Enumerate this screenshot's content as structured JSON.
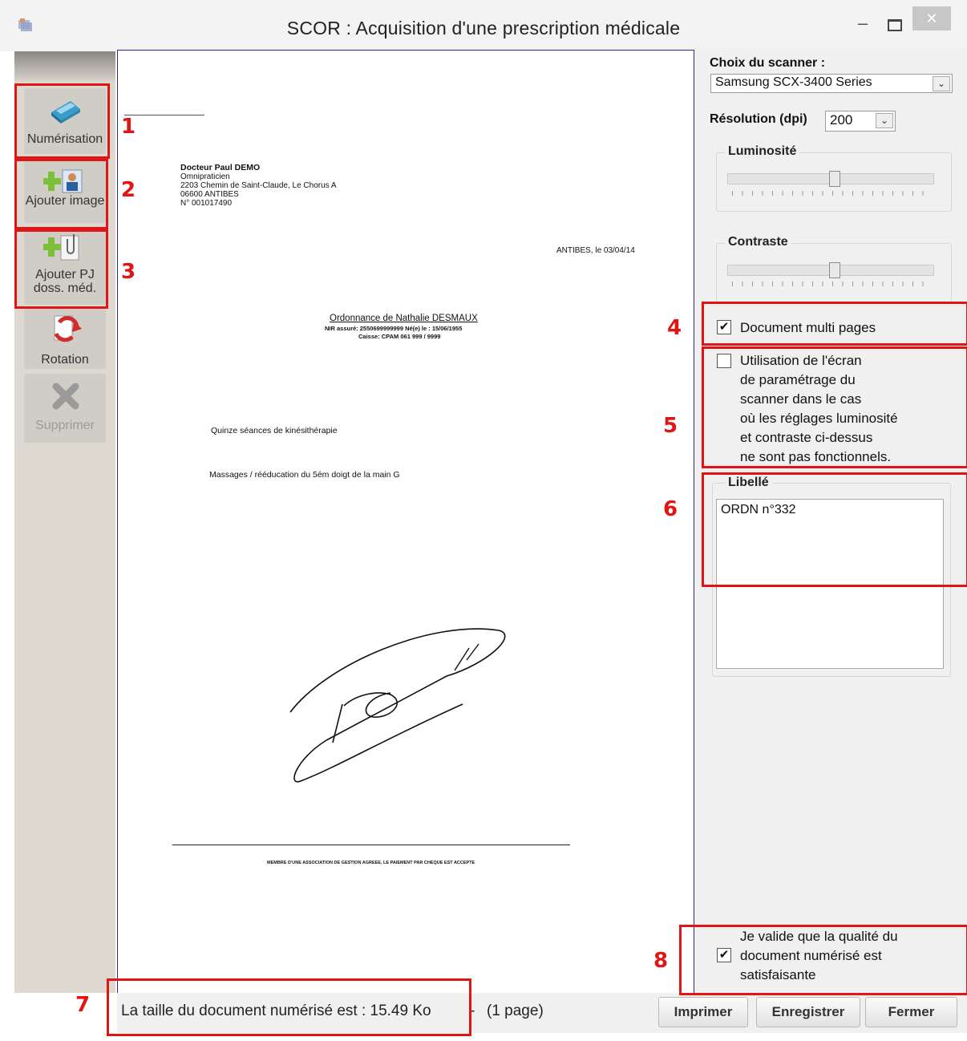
{
  "window": {
    "title": "SCOR : Acquisition d'une prescription médicale",
    "close_glyph": "✕",
    "minimize_glyph": "–"
  },
  "toolbar": {
    "scan_label": "Numérisation",
    "add_image_label": "Ajouter image",
    "add_attachment_label": "Ajouter PJ doss. méd.",
    "rotate_label": "Rotation",
    "delete_label": "Supprimer"
  },
  "document": {
    "doctor_name": "Docteur Paul DEMO",
    "specialty": "Omnipraticien",
    "address": "2203 Chemin de Saint-Claude, Le Chorus A",
    "city": "06600 ANTIBES",
    "number": "N° 001017490",
    "date_line": "ANTIBES, le 03/04/14",
    "prescription_title": "Ordonnance de Nathalie DESMAUX",
    "insured_line": "NIR assuré: 2550699999999   Né(e) le : 15/06/1955",
    "fund_line": "Caisse: CPAM 061 999 / 9999",
    "line1": "Quinze séances de kinésithérapie",
    "line2": "Massages / rééducation du 5ém doigt de la main G",
    "footer": "MEMBRE D'UNE ASSOCIATION DE GESTION AGREEE, LE PAIEMENT PAR CHEQUE EST ACCEPTE"
  },
  "panel": {
    "scanner_label": "Choix du scanner :",
    "scanner_value": "Samsung SCX-3400 Series",
    "resolution_label": "Résolution (dpi)",
    "resolution_value": "200",
    "brightness_label": "Luminosité",
    "brightness_level": 0.52,
    "contrast_label": "Contraste",
    "contrast_level": 0.52,
    "multipage_label": "Document multi pages",
    "multipage_checked": true,
    "settings_screen_lines": [
      "Utilisation de l'écran",
      "de paramétrage du",
      "scanner dans le cas",
      "où les réglages luminosité",
      "et contraste ci-dessus",
      "ne sont pas fonctionnels."
    ],
    "settings_screen_checked": false,
    "label_title": "Libellé",
    "label_value": "ORDN n°332",
    "validate_lines": [
      "Je valide que la qualité du",
      "document numérisé est",
      "satisfaisante"
    ],
    "validate_checked": true
  },
  "footer": {
    "size_text": "La taille du document numérisé est : 15.49 Ko",
    "separator": "-",
    "pages_text": "(1 page)",
    "print_label": "Imprimer",
    "save_label": "Enregistrer",
    "close_label": "Fermer"
  },
  "annotations": [
    "1",
    "2",
    "3",
    "4",
    "5",
    "6",
    "7",
    "8"
  ],
  "colors": {
    "annotation": "#e01515",
    "toolbar_bg": "#ddd8d0",
    "panel_bg": "#f0f0f0",
    "viewer_border": "#2a2a8a"
  },
  "icons": {
    "app": "app-logo-icon",
    "scan": "scanner-icon",
    "add_image": "add-image-icon",
    "add_attachment": "add-attachment-icon",
    "rotate": "rotate-icon",
    "delete": "delete-x-icon"
  }
}
